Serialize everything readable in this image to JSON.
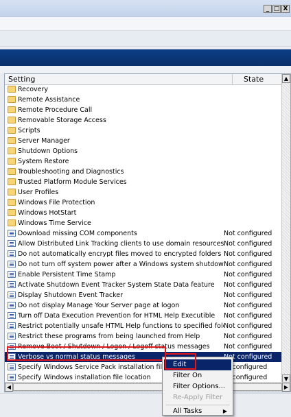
{
  "window": {
    "buttons": {
      "minimize": "_",
      "maximize": "□",
      "close": "X"
    }
  },
  "columns": {
    "setting": "Setting",
    "state": "State"
  },
  "rows": [
    {
      "type": "folder",
      "name": "Recovery",
      "state": ""
    },
    {
      "type": "folder",
      "name": "Remote Assistance",
      "state": ""
    },
    {
      "type": "folder",
      "name": "Remote Procedure Call",
      "state": ""
    },
    {
      "type": "folder",
      "name": "Removable Storage Access",
      "state": ""
    },
    {
      "type": "folder",
      "name": "Scripts",
      "state": ""
    },
    {
      "type": "folder",
      "name": "Server Manager",
      "state": ""
    },
    {
      "type": "folder",
      "name": "Shutdown Options",
      "state": ""
    },
    {
      "type": "folder",
      "name": "System Restore",
      "state": ""
    },
    {
      "type": "folder",
      "name": "Troubleshooting and Diagnostics",
      "state": ""
    },
    {
      "type": "folder",
      "name": "Trusted Platform Module Services",
      "state": ""
    },
    {
      "type": "folder",
      "name": "User Profiles",
      "state": ""
    },
    {
      "type": "folder",
      "name": "Windows File Protection",
      "state": ""
    },
    {
      "type": "folder",
      "name": "Windows HotStart",
      "state": ""
    },
    {
      "type": "folder",
      "name": "Windows Time Service",
      "state": ""
    },
    {
      "type": "policy",
      "name": "Download missing COM components",
      "state": "Not configured"
    },
    {
      "type": "policy",
      "name": "Allow Distributed Link Tracking clients to use domain resources",
      "state": "Not configured"
    },
    {
      "type": "policy",
      "name": "Do not automatically encrypt files moved to encrypted folders",
      "state": "Not configured"
    },
    {
      "type": "policy",
      "name": "Do not turn off system power after a Windows system shutdown ...",
      "state": "Not configured"
    },
    {
      "type": "policy",
      "name": "Enable Persistent Time Stamp",
      "state": "Not configured"
    },
    {
      "type": "policy",
      "name": "Activate Shutdown Event Tracker System State Data feature",
      "state": "Not configured"
    },
    {
      "type": "policy",
      "name": "Display Shutdown Event Tracker",
      "state": "Not configured"
    },
    {
      "type": "policy",
      "name": "Do not display Manage Your Server page at logon",
      "state": "Not configured"
    },
    {
      "type": "policy",
      "name": "Turn off Data Execution Prevention for HTML Help Executible",
      "state": "Not configured"
    },
    {
      "type": "policy",
      "name": "Restrict potentially unsafe HTML Help functions to specified folders",
      "state": "Not configured"
    },
    {
      "type": "policy",
      "name": "Restrict these programs from being launched from Help",
      "state": "Not configured"
    },
    {
      "type": "policy",
      "name": "Remove Boot / Shutdown / Logon / Logoff status messages",
      "state": "Not configured"
    },
    {
      "type": "policy",
      "name": "Verbose vs normal status messages",
      "state": "Not configured",
      "selected": true
    },
    {
      "type": "policy",
      "name": "Specify Windows Service Pack installation file loc",
      "state": "ot configured"
    },
    {
      "type": "policy",
      "name": "Specify Windows installation file location",
      "state": "ot configured"
    }
  ],
  "context_menu": {
    "edit": "Edit",
    "filter_on": "Filter On",
    "filter_options": "Filter Options...",
    "reapply_filter": "Re-Apply Filter",
    "all_tasks": "All Tasks",
    "all_tasks_arrow": "▶"
  },
  "scroll": {
    "up": "▲",
    "down": "▼",
    "left": "◀",
    "right": "▶"
  },
  "colors": {
    "selection": "#0a246a",
    "highlight_box": "#e0161b",
    "header_band": "#0b3f86"
  }
}
